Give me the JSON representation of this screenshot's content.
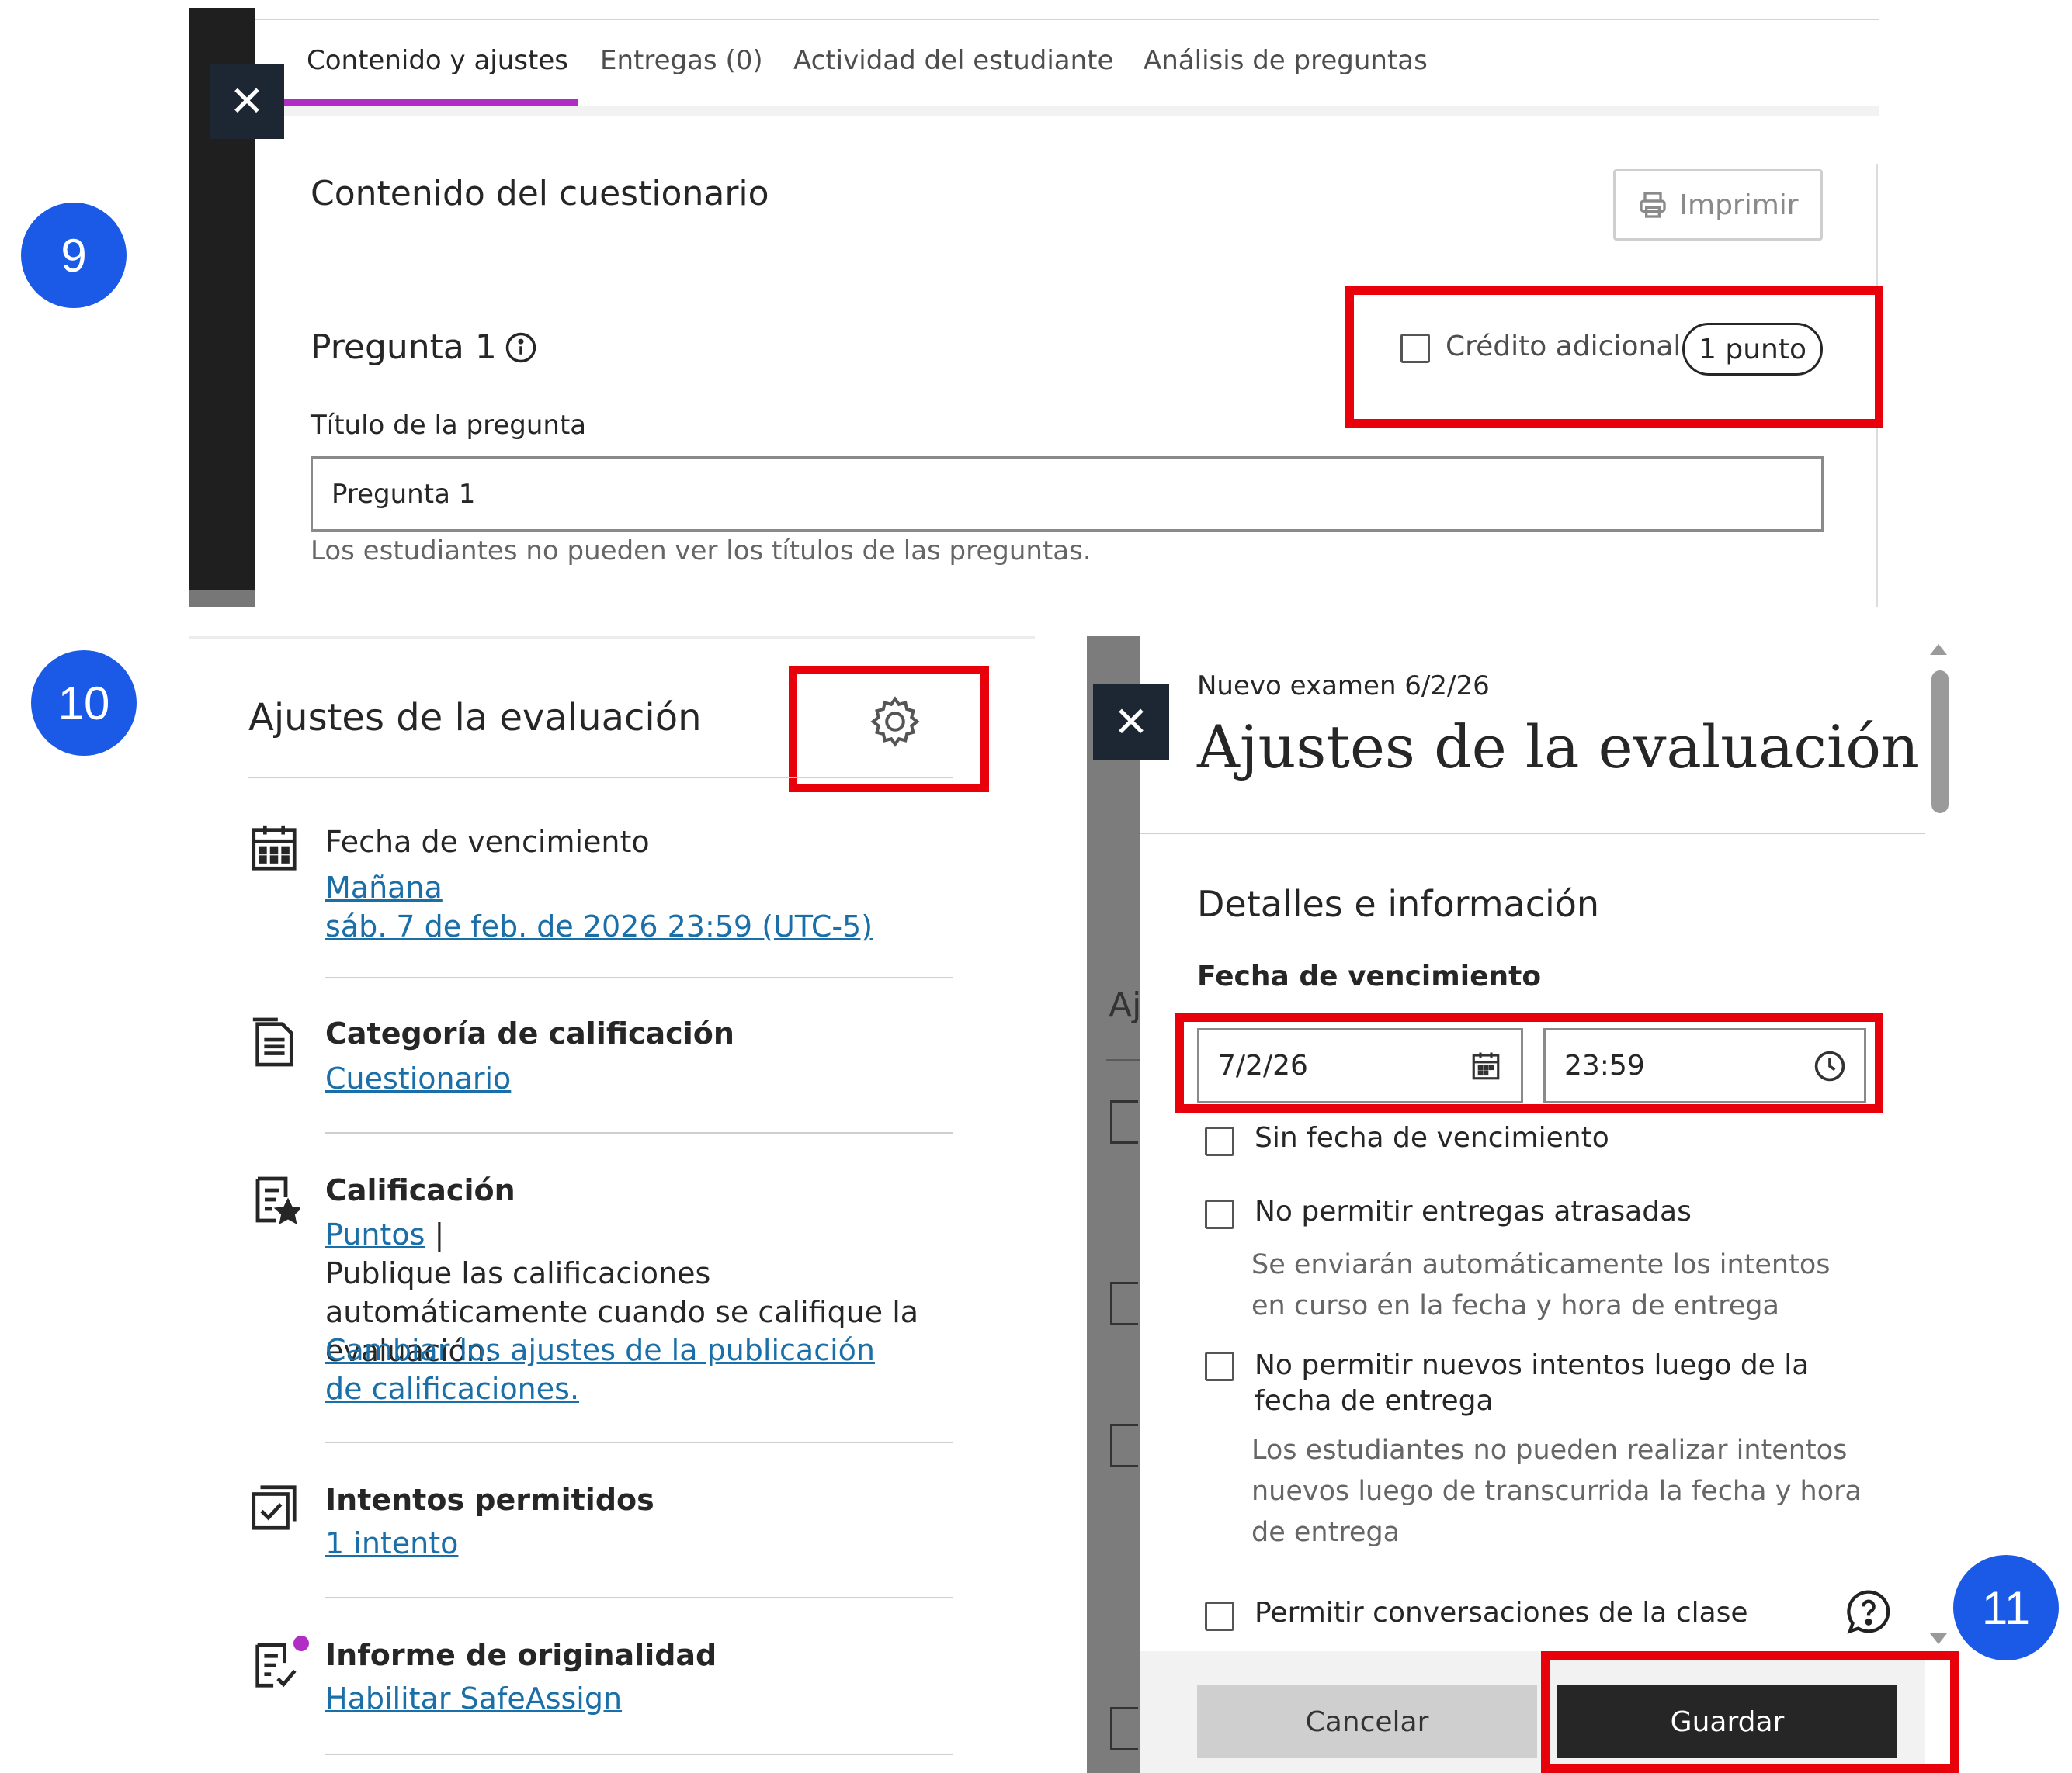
{
  "step_badges": {
    "nine": "9",
    "ten": "10",
    "eleven": "11"
  },
  "quiz_panel": {
    "tabs": [
      {
        "label": "Contenido y ajustes",
        "active": true
      },
      {
        "label": "Entregas (0)"
      },
      {
        "label": "Actividad del estudiante"
      },
      {
        "label": "Análisis de preguntas"
      }
    ],
    "section_title": "Contenido del cuestionario",
    "print_label": "Imprimir",
    "question_heading": "Pregunta 1",
    "extra_credit_label": "Crédito adicional",
    "points_label": "1 punto",
    "question_title_label": "Título de la pregunta",
    "question_title_value": "Pregunta 1",
    "question_title_help": "Los estudiantes no pueden ver los títulos de las preguntas."
  },
  "settings_panel": {
    "title": "Ajustes de la evaluación",
    "due": {
      "label": "Fecha de vencimiento",
      "link1": "Mañana",
      "link2": "sáb. 7 de feb. de 2026 23:59 (UTC-5)"
    },
    "category": {
      "label": "Categoría de calificación",
      "link": "Cuestionario"
    },
    "grading": {
      "label": "Calificación",
      "link": "Puntos",
      "separator": "|",
      "text": "Publique las calificaciones automáticamente cuando se califique la evaluación.",
      "link2": "Cambiar los ajustes de la publicación de calificaciones."
    },
    "attempts": {
      "label": "Intentos permitidos",
      "link": "1 intento"
    },
    "originality": {
      "label": "Informe de originalidad",
      "link": "Habilitar SafeAssign"
    }
  },
  "dialog": {
    "subtitle": "Nuevo examen 6/2/26",
    "title": "Ajustes de la evaluación",
    "section": "Detalles e información",
    "due_label": "Fecha de vencimiento",
    "date_value": "7/2/26",
    "time_value": "23:59",
    "options": [
      {
        "label": "Sin fecha de vencimiento"
      },
      {
        "label": "No permitir entregas atrasadas",
        "help": "Se enviarán automáticamente los intentos en curso en la fecha y hora de entrega"
      },
      {
        "label": "No permitir nuevos intentos luego de la fecha de entrega",
        "help": "Los estudiantes no pueden realizar intentos nuevos luego de transcurrida la fecha y hora de entrega"
      },
      {
        "label": "Permitir conversaciones de la clase"
      }
    ],
    "peek_text": "Aj",
    "cancel_label": "Cancelar",
    "save_label": "Guardar"
  },
  "colors": {
    "highlight_box": "#e8000b",
    "step_badge": "#1a5ae6",
    "active_tab_underline": "#b02cc4",
    "link": "#1a6fa8",
    "dark_button": "#262626",
    "close_button": "#1d2633"
  }
}
